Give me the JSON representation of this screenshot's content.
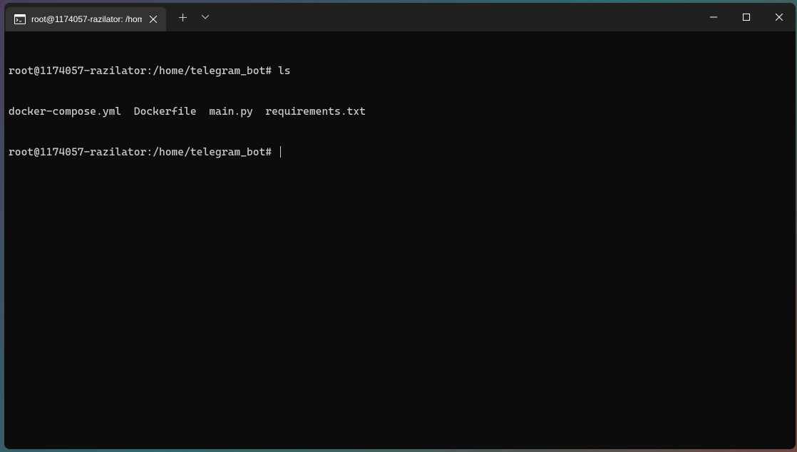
{
  "tab": {
    "title": "root@1174057-razilator: /hom"
  },
  "terminal": {
    "lines": [
      {
        "prompt": "root@1174057-razilator:/home/telegram_bot#",
        "command": "ls"
      },
      {
        "output": "docker-compose.yml  Dockerfile  main.py  requirements.txt"
      },
      {
        "prompt": "root@1174057-razilator:/home/telegram_bot#",
        "command": ""
      }
    ]
  }
}
